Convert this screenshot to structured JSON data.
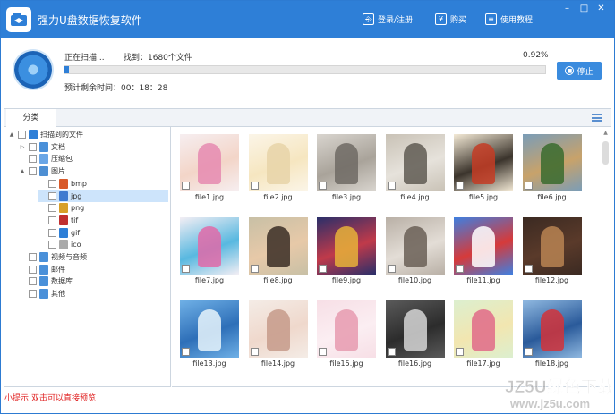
{
  "app": {
    "title": "强力U盘数据恢复软件"
  },
  "toolbar": {
    "login_label": "登录/注册",
    "buy_label": "购买",
    "tutorial_label": "使用教程"
  },
  "scan": {
    "status": "正在扫描...",
    "found": "找到：1680个文件",
    "percent": "0.92%",
    "progress": 0.0092,
    "remaining": "预计剩余时间：00：18：28",
    "stop_label": "停止"
  },
  "tabs": [
    {
      "label": "分类"
    }
  ],
  "tree": [
    {
      "label": "扫描到的文件",
      "toggle": "▲",
      "icon": "folder-scan-icon",
      "color": "#2e7fd7"
    },
    {
      "label": "文档",
      "toggle": "▷",
      "icon": "document-icon",
      "color": "#4a90d9"
    },
    {
      "label": "压缩包",
      "toggle": "",
      "icon": "archive-icon",
      "color": "#6aa6e6"
    },
    {
      "label": "图片",
      "toggle": "▲",
      "icon": "image-icon",
      "color": "#4e8fd3"
    },
    {
      "label": "bmp",
      "toggle": "",
      "icon": "bmp-icon",
      "color": "#d85a2a"
    },
    {
      "label": "jpg",
      "toggle": "",
      "icon": "jpg-icon",
      "color": "#3f7bd0"
    },
    {
      "label": "png",
      "toggle": "",
      "icon": "png-icon",
      "color": "#d8a02a"
    },
    {
      "label": "tif",
      "toggle": "",
      "icon": "tif-icon",
      "color": "#c03030"
    },
    {
      "label": "gif",
      "toggle": "",
      "icon": "gif-icon",
      "color": "#2e7fd7"
    },
    {
      "label": "ico",
      "toggle": "",
      "icon": "ico-icon",
      "color": "#aaaaaa"
    },
    {
      "label": "视频与音频",
      "toggle": "",
      "icon": "media-icon",
      "color": "#4a90d9"
    },
    {
      "label": "邮件",
      "toggle": "",
      "icon": "mail-icon",
      "color": "#4a90d9"
    },
    {
      "label": "数据库",
      "toggle": "",
      "icon": "database-icon",
      "color": "#4a90d9"
    },
    {
      "label": "其他",
      "toggle": "",
      "icon": "other-icon",
      "color": "#4a90d9"
    }
  ],
  "files": [
    {
      "name": "file1.jpg",
      "bg": "#f6eef0",
      "c1": "#e58ab0",
      "c2": "#f3d5c8"
    },
    {
      "name": "file2.jpg",
      "bg": "#fbf5e8",
      "c1": "#e8d4a8",
      "c2": "#f6e6c0"
    },
    {
      "name": "file3.jpg",
      "bg": "#d9d5cf",
      "c1": "#6e6a64",
      "c2": "#a9a39a"
    },
    {
      "name": "file4.jpg",
      "bg": "#c9c2b6",
      "c1": "#5f5a52",
      "c2": "#e6e2db"
    },
    {
      "name": "file5.jpg",
      "bg": "#f4ead6",
      "c1": "#c43c24",
      "c2": "#3b342c"
    },
    {
      "name": "file6.jpg",
      "bg": "#7a9db8",
      "c1": "#3a6b2e",
      "c2": "#c8a26a"
    },
    {
      "name": "file7.jpg",
      "bg": "#f3eef4",
      "c1": "#e06aa8",
      "c2": "#58b8e0"
    },
    {
      "name": "file8.jpg",
      "bg": "#c8c0a6",
      "c1": "#3a2d25",
      "c2": "#e7c9a8"
    },
    {
      "name": "file9.jpg",
      "bg": "#2a2f6a",
      "c1": "#e6b23a",
      "c2": "#c03a4a"
    },
    {
      "name": "file10.jpg",
      "bg": "#b9b0a6",
      "c1": "#6a5f56",
      "c2": "#e3ddd6"
    },
    {
      "name": "file11.jpg",
      "bg": "#3f7fe0",
      "c1": "#ffffff",
      "c2": "#d63a3a"
    },
    {
      "name": "file12.jpg",
      "bg": "#3b2a22",
      "c1": "#b98452",
      "c2": "#5a3a2a"
    },
    {
      "name": "file13.jpg",
      "bg": "#6fb0e6",
      "c1": "#e8f4fc",
      "c2": "#2e6fb8"
    },
    {
      "name": "file14.jpg",
      "bg": "#f4ece6",
      "c1": "#c59a8a",
      "c2": "#efd8cc"
    },
    {
      "name": "file15.jpg",
      "bg": "#f7dfe6",
      "c1": "#e69aaf",
      "c2": "#fbeef2"
    },
    {
      "name": "file16.jpg",
      "bg": "#5a5a5a",
      "c1": "#d6d6d6",
      "c2": "#2c2c2c"
    },
    {
      "name": "file17.jpg",
      "bg": "#dcefcf",
      "c1": "#e06a88",
      "c2": "#f2e6b0"
    },
    {
      "name": "file18.jpg",
      "bg": "#8fb8e0",
      "c1": "#d2333a",
      "c2": "#2a5a9a"
    }
  ],
  "footer": {
    "tip": "小提示:双击可以直接预览"
  },
  "watermark": {
    "text": "JZ5U绿色下载",
    "url": "www.jz5u.com"
  },
  "colors": {
    "primary": "#2e7fd7",
    "tip": "#e02020"
  }
}
